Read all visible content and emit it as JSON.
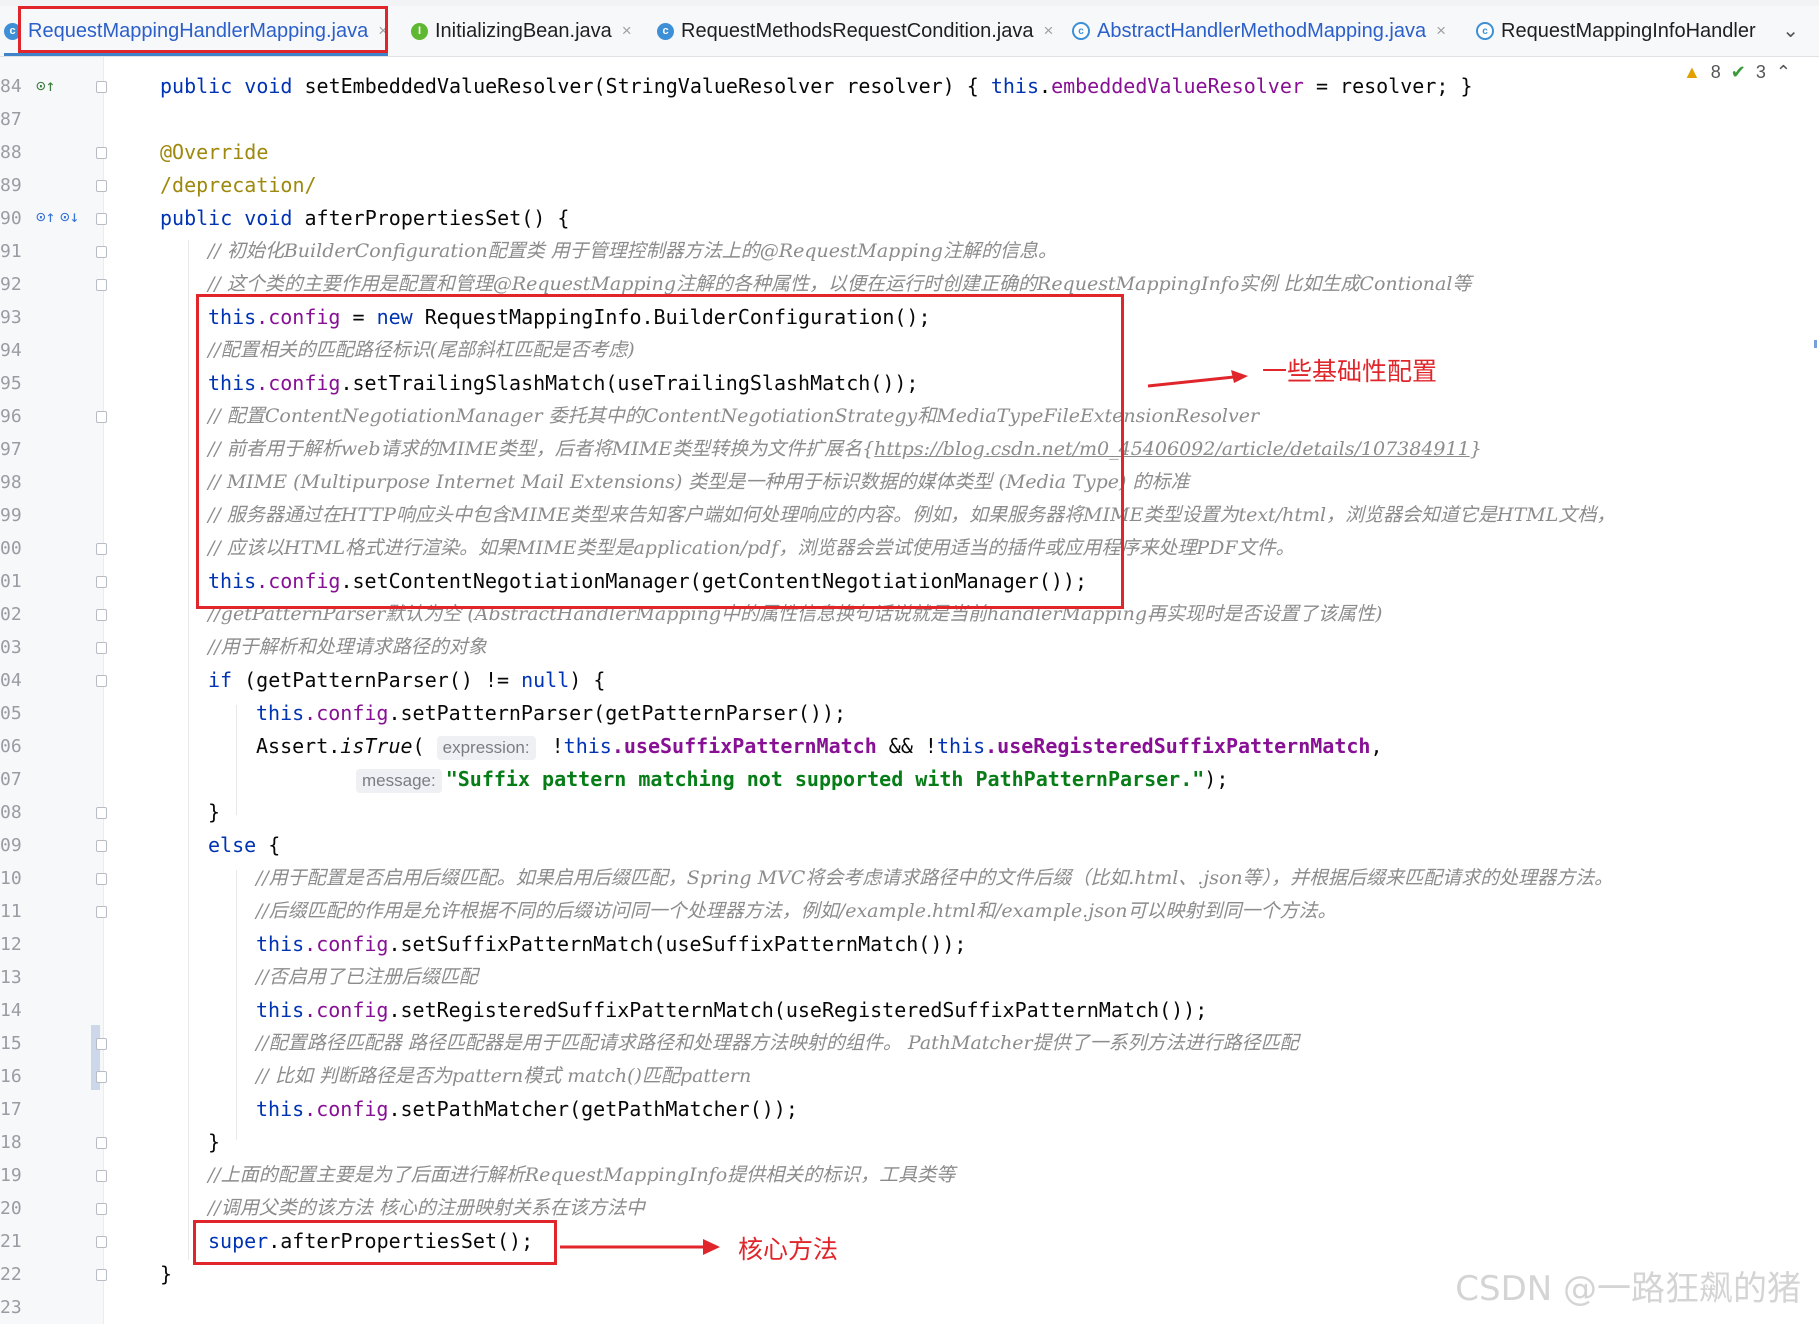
{
  "tabs": [
    {
      "label": "RequestMappingHandlerMapping.java",
      "icon": "class-icon",
      "active": true
    },
    {
      "label": "InitializingBean.java",
      "icon": "interface-icon",
      "active": false
    },
    {
      "label": "RequestMethodsRequestCondition.java",
      "icon": "class-icon",
      "active": false
    },
    {
      "label": "AbstractHandlerMethodMapping.java",
      "icon": "abstract-class-icon",
      "active": false
    },
    {
      "label": "RequestMappingInfoHandler",
      "icon": "abstract-class-icon",
      "active": false
    }
  ],
  "inspections": {
    "warnings": "8",
    "checks": "3"
  },
  "line_numbers": [
    "84",
    "87",
    "88",
    "89",
    "90",
    "91",
    "92",
    "93",
    "94",
    "95",
    "96",
    "97",
    "98",
    "99",
    "00",
    "01",
    "02",
    "03",
    "04",
    "05",
    "06",
    "07",
    "08",
    "09",
    "10",
    "11",
    "12",
    "13",
    "14",
    "15",
    "16",
    "17",
    "18",
    "19",
    "20",
    "21",
    "22",
    "23"
  ],
  "code": {
    "l84_a": "public void ",
    "l84_b": "setEmbeddedValueResolver(StringValueResolver resolver) { ",
    "l84_c": "this",
    "l84_d": ".",
    "l84_e": "embeddedValueResolver",
    "l84_f": " = resolver; }",
    "l88": "@Override",
    "l89": "/deprecation/",
    "l90_a": "public void ",
    "l90_b": "afterPropertiesSet() {",
    "l91": "// 初始化BuilderConfiguration配置类 用于管理控制器方法上的@RequestMapping注解的信息。",
    "l92": "// 这个类的主要作用是配置和管理@RequestMapping注解的各种属性，以便在运行时创建正确的RequestMappingInfo实例 比如生成Contional等",
    "l93_a": "this",
    "l93_b": ".config",
    "l93_c": " = ",
    "l93_d": "new ",
    "l93_e": "RequestMappingInfo.BuilderConfiguration();",
    "l94": "//配置相关的匹配路径标识(尾部斜杠匹配是否考虑)",
    "l95_a": "this",
    "l95_b": ".config",
    "l95_c": ".setTrailingSlashMatch(useTrailingSlashMatch());",
    "l96": "// 配置ContentNegotiationManager 委托其中的ContentNegotiationStrategy和MediaTypeFileExtensionResolver",
    "l97_a": "// 前者用于解析web请求的MIME类型，后者将MIME类型转换为文件扩展名{",
    "l97_b": "https://blog.csdn.net/m0_45406092/article/details/107384911",
    "l97_c": "}",
    "l98": "// MIME (Multipurpose Internet Mail Extensions) 类型是一种用于标识数据的媒体类型 (Media Type) 的标准",
    "l99": "// 服务器通过在HTTP响应头中包含MIME类型来告知客户端如何处理响应的内容。例如，如果服务器将MIME类型设置为text/html，浏览器会知道它是HTML文档，",
    "l200": "// 应该以HTML格式进行渲染。如果MIME类型是application/pdf，浏览器会尝试使用适当的插件或应用程序来处理PDF文件。",
    "l201_a": "this",
    "l201_b": ".config",
    "l201_c": ".setContentNegotiationManager(getContentNegotiationManager());",
    "l202": "//getPatternParser默认为空 (AbstractHandlerMapping中的属性信息换句话说就是当前handlerMapping再实现时是否设置了该属性)",
    "l203": "//用于解析和处理请求路径的对象",
    "l204_a": "if ",
    "l204_b": "(getPatternParser() != ",
    "l204_c": "null",
    "l204_d": ") {",
    "l205_a": "this",
    "l205_b": ".config",
    "l205_c": ".setPatternParser(getPatternParser());",
    "l206_a": "Assert.",
    "l206_b": "isTrue",
    "l206_c": "( ",
    "l206_hint": "expression:",
    "l206_d": " !",
    "l206_e": "this",
    "l206_f": ".useSuffixPatternMatch",
    "l206_g": " && !",
    "l206_h": "this",
    "l206_i": ".useRegisteredSuffixPatternMatch",
    "l206_j": ",",
    "l207_hint": "message:",
    "l207_a": "\"Suffix pattern matching not supported with PathPatternParser.\"",
    "l207_b": ");",
    "l208": "}",
    "l209_a": "else ",
    "l209_b": "{",
    "l210": "//用于配置是否启用后缀匹配。如果启用后缀匹配，Spring MVC将会考虑请求路径中的文件后缀（比如.html、.json等），并根据后缀来匹配请求的处理器方法。",
    "l211": "//后缀匹配的作用是允许根据不同的后缀访问同一个处理器方法，例如/example.html和/example.json可以映射到同一个方法。",
    "l212_a": "this",
    "l212_b": ".config",
    "l212_c": ".setSuffixPatternMatch(useSuffixPatternMatch());",
    "l213": "//否启用了已注册后缀匹配",
    "l214_a": "this",
    "l214_b": ".config",
    "l214_c": ".setRegisteredSuffixPatternMatch(useRegisteredSuffixPatternMatch());",
    "l215": "//配置路径匹配器 路径匹配器是用于匹配请求路径和处理器方法映射的组件。 PathMatcher提供了一系列方法进行路径匹配",
    "l216": "// 比如 判断路径是否为pattern模式 match()匹配pattern",
    "l217_a": "this",
    "l217_b": ".config",
    "l217_c": ".setPathMatcher(getPathMatcher());",
    "l218": "}",
    "l219": "//上面的配置主要是为了后面进行解析RequestMappingInfo提供相关的标识，工具类等",
    "l220": "//调用父类的该方法 核心的注册映射关系在该方法中",
    "l221_a": "super",
    "l221_b": ".afterPropertiesSet();",
    "l222": "}"
  },
  "annotations": {
    "basic_config": "一些基础性配置",
    "core_method": "核心方法"
  },
  "watermark": "CSDN @一路狂飙的猪"
}
